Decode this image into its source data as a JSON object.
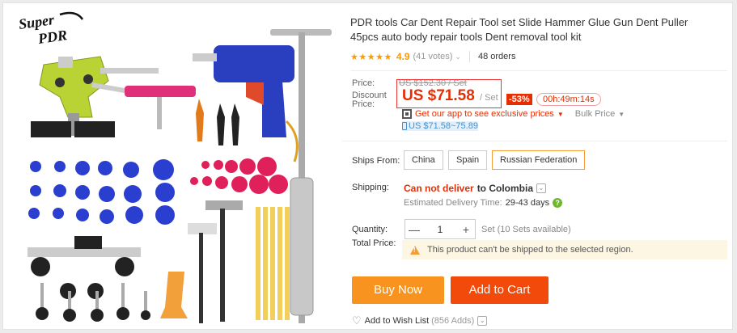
{
  "product": {
    "title": "PDR tools Car Dent Repair Tool set Slide Hammer Glue Gun Dent Puller 45pcs auto body repair tools Dent removal tool kit",
    "brand_logo_text": "Super PDR",
    "stars": "★★★★★",
    "rating": "4.9",
    "votes": "(41 votes)",
    "orders": "48 orders"
  },
  "price": {
    "price_label": "Price:",
    "discount_label_1": "Discount",
    "discount_label_2": "Price:",
    "old_price": "US $152.30 / Set",
    "current_price": "US $71.58",
    "per_unit": "/ Set",
    "discount_badge": "-53%",
    "timer": "00h:49m:14s",
    "app_text": "Get our app to see exclusive prices",
    "bulk_price": "Bulk Price",
    "range": "US $71.58~75.89"
  },
  "shipping": {
    "ships_from_label": "Ships From:",
    "options": [
      "China",
      "Spain",
      "Russian Federation"
    ],
    "selected": "Russian Federation",
    "shipping_label": "Shipping:",
    "cannot_deliver": "Can not deliver",
    "to_destination": "to Colombia",
    "estimated_label": "Estimated Delivery Time:",
    "estimated_days": "29-43 days"
  },
  "quantity": {
    "label": "Quantity:",
    "value": "1",
    "minus": "—",
    "plus": "+",
    "note": "Set (10 Sets available)"
  },
  "total": {
    "label": "Total Price:",
    "warning": "This product can't be shipped to the selected region."
  },
  "actions": {
    "buy_now": "Buy Now",
    "add_to_cart": "Add to Cart",
    "wishlist": "Add to Wish List",
    "wishlist_count": "(856 Adds)"
  },
  "colors": {
    "price_red": "#e62e04",
    "buy_orange": "#f7931e",
    "cart_red": "#f24a0a",
    "star_orange": "#ff9900"
  }
}
